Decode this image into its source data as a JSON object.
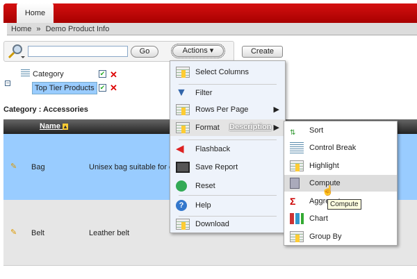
{
  "tabs": [
    {
      "label": "Home"
    }
  ],
  "breadcrumb": {
    "home": "Home",
    "sep": "»",
    "current": "Demo Product Info"
  },
  "search": {
    "value": "",
    "go": "Go",
    "actions": "Actions",
    "create": "Create"
  },
  "filters": [
    {
      "label": "Category"
    },
    {
      "label": "Top Tier Products"
    }
  ],
  "group_header": "Category : Accessories",
  "table": {
    "columns": [
      "Name",
      "Description"
    ],
    "rows": [
      {
        "name": "Bag",
        "description": "Unisex bag suitable for carrying laptops with room for many additional items"
      },
      {
        "name": "Belt",
        "description": "Leather belt"
      }
    ]
  },
  "actions_menu": [
    "Select Columns",
    "Filter",
    "Rows Per Page",
    "Format",
    "Flashback",
    "Save Report",
    "Reset",
    "Help",
    "Download"
  ],
  "format_menu": [
    "Sort",
    "Control Break",
    "Highlight",
    "Compute",
    "Aggregate",
    "Chart",
    "Group By"
  ],
  "tooltip": "Compute"
}
